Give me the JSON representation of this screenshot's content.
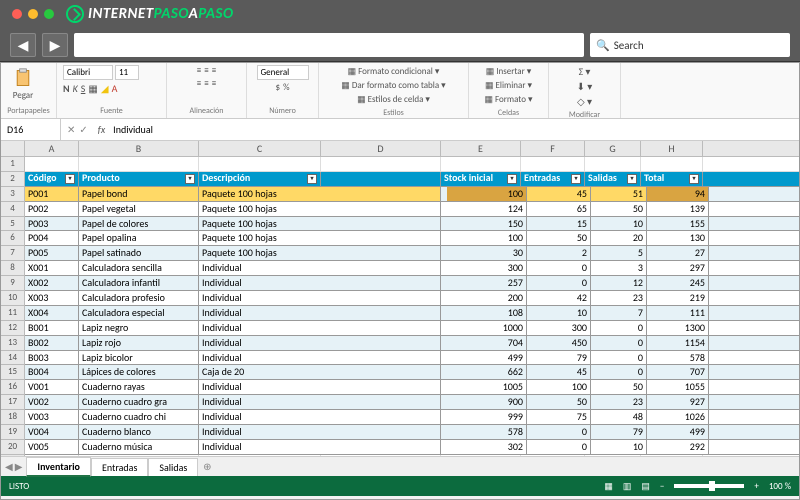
{
  "browser": {
    "logo_text_1": "INTERNET",
    "logo_text_2": "PASO",
    "logo_text_3": "A",
    "logo_text_4": "PASO",
    "search_placeholder": "Search"
  },
  "ribbon": {
    "paste_label": "Pegar",
    "group_clipboard": "Portapapeles",
    "font_name": "Calibri",
    "font_size": "11",
    "group_font": "Fuente",
    "group_align": "Alineación",
    "number_format": "General",
    "group_number": "Número",
    "cond_format": "Formato condicional",
    "as_table": "Dar formato como tabla",
    "cell_styles": "Estilos de celda",
    "group_styles": "Estilos",
    "insert": "Insertar",
    "delete": "Eliminar",
    "format": "Formato",
    "group_cells": "Celdas",
    "group_edit": "Modificar"
  },
  "formula": {
    "cell_ref": "D16",
    "value": "Individual"
  },
  "columns": [
    "A",
    "B",
    "C",
    "D",
    "E",
    "F",
    "G",
    "H"
  ],
  "table": {
    "headers": [
      "Código",
      "Producto",
      "Descripción",
      "Stock inicial",
      "Entradas",
      "Salidas",
      "Total"
    ],
    "rows": [
      {
        "code": "P001",
        "prod": "Papel bond",
        "desc": "Paquete 100 hojas",
        "stock": 100,
        "in": 45,
        "out": 51,
        "total": 94,
        "hl": true
      },
      {
        "code": "P002",
        "prod": "Papel vegetal",
        "desc": "Paquete 100 hojas",
        "stock": 124,
        "in": 65,
        "out": 50,
        "total": 139
      },
      {
        "code": "P003",
        "prod": "Papel de colores",
        "desc": "Paquete 100 hojas",
        "stock": 150,
        "in": 15,
        "out": 10,
        "total": 155
      },
      {
        "code": "P004",
        "prod": "Papel opalina",
        "desc": "Paquete 100 hojas",
        "stock": 100,
        "in": 50,
        "out": 20,
        "total": 130
      },
      {
        "code": "P005",
        "prod": "Papel satinado",
        "desc": "Paquete 100 hojas",
        "stock": 30,
        "in": 2,
        "out": 5,
        "total": 27
      },
      {
        "code": "X001",
        "prod": "Calculadora sencilla",
        "desc": "Individual",
        "stock": 300,
        "in": 0,
        "out": 3,
        "total": 297
      },
      {
        "code": "X002",
        "prod": "Calculadora infantil",
        "desc": "Individual",
        "stock": 257,
        "in": 0,
        "out": 12,
        "total": 245
      },
      {
        "code": "X003",
        "prod": "Calculadora profesio",
        "desc": "Individual",
        "stock": 200,
        "in": 42,
        "out": 23,
        "total": 219
      },
      {
        "code": "X004",
        "prod": "Calculadora especial",
        "desc": "Individual",
        "stock": 108,
        "in": 10,
        "out": 7,
        "total": 111
      },
      {
        "code": "B001",
        "prod": "Lapiz negro",
        "desc": "Individual",
        "stock": 1000,
        "in": 300,
        "out": 0,
        "total": 1300
      },
      {
        "code": "B002",
        "prod": "Lapiz rojo",
        "desc": "Individual",
        "stock": 704,
        "in": 450,
        "out": 0,
        "total": 1154
      },
      {
        "code": "B003",
        "prod": "Lapiz bicolor",
        "desc": "Individual",
        "stock": 499,
        "in": 79,
        "out": 0,
        "total": 578
      },
      {
        "code": "B004",
        "prod": "Lápices de colores",
        "desc": "Caja de 20",
        "stock": 662,
        "in": 45,
        "out": 0,
        "total": 707
      },
      {
        "code": "V001",
        "prod": "Cuaderno rayas",
        "desc": "Individual",
        "stock": 1005,
        "in": 100,
        "out": 50,
        "total": 1055
      },
      {
        "code": "V002",
        "prod": "Cuaderno cuadro gra",
        "desc": "Individual",
        "stock": 900,
        "in": 50,
        "out": 23,
        "total": 927
      },
      {
        "code": "V003",
        "prod": "Cuaderno cuadro chi",
        "desc": "Individual",
        "stock": 999,
        "in": 75,
        "out": 48,
        "total": 1026
      },
      {
        "code": "V004",
        "prod": "Cuaderno blanco",
        "desc": "Individual",
        "stock": 578,
        "in": 0,
        "out": 79,
        "total": 499
      },
      {
        "code": "V005",
        "prod": "Cuaderno música",
        "desc": "Individual",
        "stock": 302,
        "in": 0,
        "out": 10,
        "total": 292
      }
    ]
  },
  "sheets": {
    "tab1": "Inventario",
    "tab2": "Entradas",
    "tab3": "Salidas"
  },
  "status": {
    "ready": "LISTO",
    "zoom": "100 %"
  }
}
